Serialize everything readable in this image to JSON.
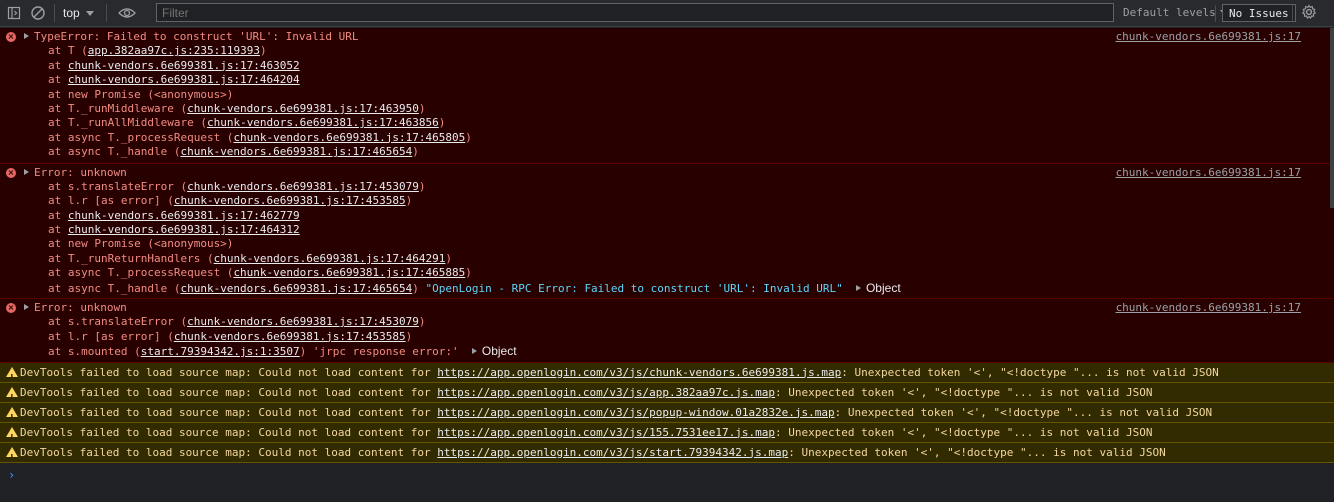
{
  "toolbar": {
    "context": "top",
    "filter_placeholder": "Filter",
    "levels": "Default levels",
    "issues": "No Issues"
  },
  "errors": [
    {
      "title": "TypeError: Failed to construct 'URL': Invalid URL",
      "source": "chunk-vendors.6e699381.js:17",
      "frames": [
        {
          "prefix": "at T (",
          "link": "app.382aa97c.js:235:119393",
          "suffix": ")"
        },
        {
          "prefix": "at ",
          "link": "chunk-vendors.6e699381.js:17:463052",
          "suffix": ""
        },
        {
          "prefix": "at ",
          "link": "chunk-vendors.6e699381.js:17:464204",
          "suffix": ""
        },
        {
          "prefix": "at new Promise (<anonymous>)",
          "link": "",
          "suffix": ""
        },
        {
          "prefix": "at T._runMiddleware (",
          "link": "chunk-vendors.6e699381.js:17:463950",
          "suffix": ")"
        },
        {
          "prefix": "at T._runAllMiddleware (",
          "link": "chunk-vendors.6e699381.js:17:463856",
          "suffix": ")"
        },
        {
          "prefix": "at async T._processRequest (",
          "link": "chunk-vendors.6e699381.js:17:465805",
          "suffix": ")"
        },
        {
          "prefix": "at async T._handle (",
          "link": "chunk-vendors.6e699381.js:17:465654",
          "suffix": ")"
        }
      ]
    },
    {
      "title": "Error: unknown",
      "source": "chunk-vendors.6e699381.js:17",
      "frames": [
        {
          "prefix": "at s.translateError (",
          "link": "chunk-vendors.6e699381.js:17:453079",
          "suffix": ")"
        },
        {
          "prefix": "at l.r [as error] (",
          "link": "chunk-vendors.6e699381.js:17:453585",
          "suffix": ")"
        },
        {
          "prefix": "at ",
          "link": "chunk-vendors.6e699381.js:17:462779",
          "suffix": ""
        },
        {
          "prefix": "at ",
          "link": "chunk-vendors.6e699381.js:17:464312",
          "suffix": ""
        },
        {
          "prefix": "at new Promise (<anonymous>)",
          "link": "",
          "suffix": ""
        },
        {
          "prefix": "at T._runReturnHandlers (",
          "link": "chunk-vendors.6e699381.js:17:464291",
          "suffix": ")"
        },
        {
          "prefix": "at async T._processRequest (",
          "link": "chunk-vendors.6e699381.js:17:465885",
          "suffix": ")"
        },
        {
          "prefix": "at async T._handle (",
          "link": "chunk-vendors.6e699381.js:17:465654",
          "suffix": ")",
          "trail": " \"OpenLogin - RPC Error: Failed to construct 'URL': Invalid URL\"",
          "object": "Object"
        }
      ]
    },
    {
      "title": "Error: unknown",
      "source": "chunk-vendors.6e699381.js:17",
      "frames": [
        {
          "prefix": "at s.translateError (",
          "link": "chunk-vendors.6e699381.js:17:453079",
          "suffix": ")"
        },
        {
          "prefix": "at l.r [as error] (",
          "link": "chunk-vendors.6e699381.js:17:453585",
          "suffix": ")"
        },
        {
          "prefix": "at s.mounted (",
          "link": "start.79394342.js:1:3507",
          "suffix": ")",
          "trail": " 'jrpc response error:'",
          "object": "Object"
        }
      ]
    }
  ],
  "warnings": [
    {
      "prefix": "DevTools failed to load source map: Could not load content for ",
      "url": "https://app.openlogin.com/v3/js/chunk-vendors.6e699381.js.map",
      "suffix": ": Unexpected token '<', \"<!doctype \"... is not valid JSON"
    },
    {
      "prefix": "DevTools failed to load source map: Could not load content for ",
      "url": "https://app.openlogin.com/v3/js/app.382aa97c.js.map",
      "suffix": ": Unexpected token '<', \"<!doctype \"... is not valid JSON"
    },
    {
      "prefix": "DevTools failed to load source map: Could not load content for ",
      "url": "https://app.openlogin.com/v3/js/popup-window.01a2832e.js.map",
      "suffix": ": Unexpected token '<', \"<!doctype \"... is not valid JSON"
    },
    {
      "prefix": "DevTools failed to load source map: Could not load content for ",
      "url": "https://app.openlogin.com/v3/js/155.7531ee17.js.map",
      "suffix": ": Unexpected token '<', \"<!doctype \"... is not valid JSON"
    },
    {
      "prefix": "DevTools failed to load source map: Could not load content for ",
      "url": "https://app.openlogin.com/v3/js/start.79394342.js.map",
      "suffix": ": Unexpected token '<', \"<!doctype \"... is not valid JSON"
    }
  ],
  "prompt": "›"
}
